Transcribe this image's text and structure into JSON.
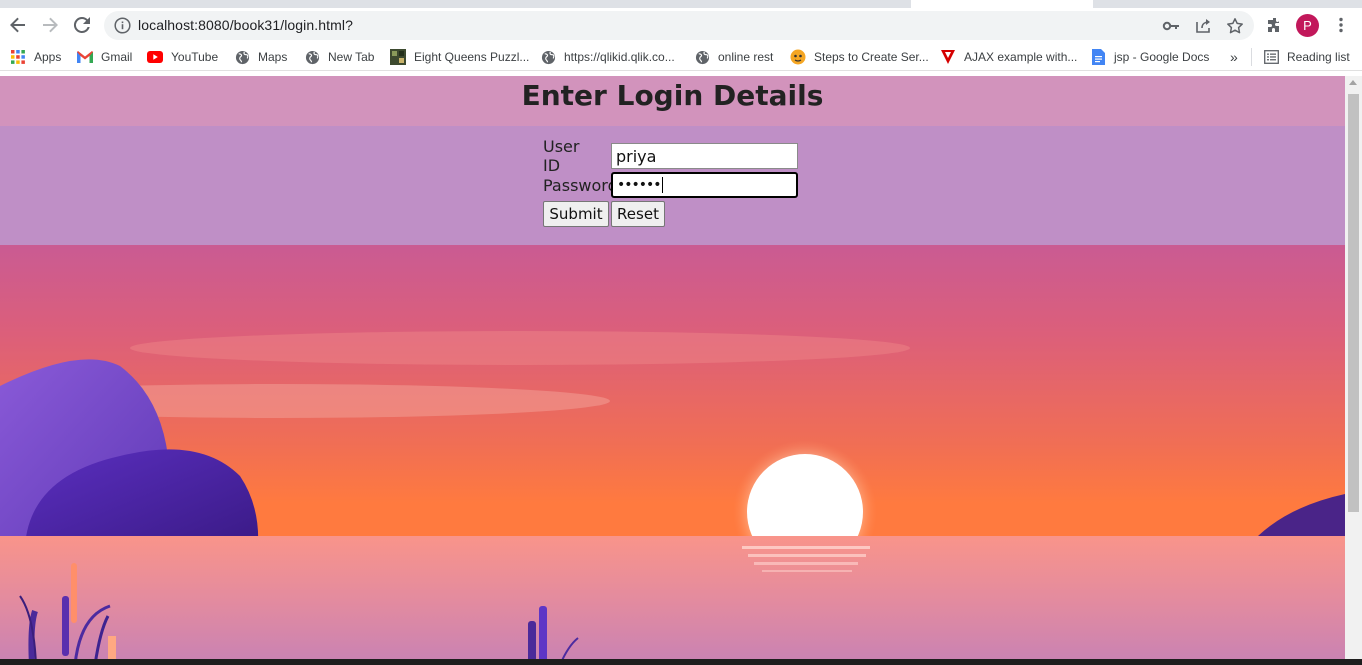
{
  "browser": {
    "url": "localhost:8080/book31/login.html?",
    "profile_initial": "P"
  },
  "bookmarks": [
    {
      "label": "Apps",
      "icon": "apps-grid-icon"
    },
    {
      "label": "Gmail",
      "icon": "gmail-icon"
    },
    {
      "label": "YouTube",
      "icon": "youtube-icon"
    },
    {
      "label": "Maps",
      "icon": "globe-icon"
    },
    {
      "label": "New Tab",
      "icon": "globe-icon"
    },
    {
      "label": "Eight Queens Puzzl...",
      "icon": "image-favicon-icon"
    },
    {
      "label": "https://qlikid.qlik.co...",
      "icon": "globe-icon"
    },
    {
      "label": "online rest",
      "icon": "globe-icon"
    },
    {
      "label": "Steps to Create Ser...",
      "icon": "tiger-favicon-icon"
    },
    {
      "label": "AJAX example with...",
      "icon": "red-triangle-favicon-icon"
    },
    {
      "label": "jsp - Google Docs",
      "icon": "google-docs-icon"
    }
  ],
  "bookmarks_overflow": "»",
  "reading_list": "Reading list",
  "page": {
    "title": "Enter Login Details",
    "form": {
      "user_id_label": "User ID",
      "user_id_value": "priya",
      "password_label": "Password",
      "password_value": "••••••",
      "submit_label": "Submit",
      "reset_label": "Reset"
    }
  },
  "colors": {
    "accent_profile": "#c2185b",
    "header_band": "#d298be",
    "form_band": "#be92c8"
  }
}
